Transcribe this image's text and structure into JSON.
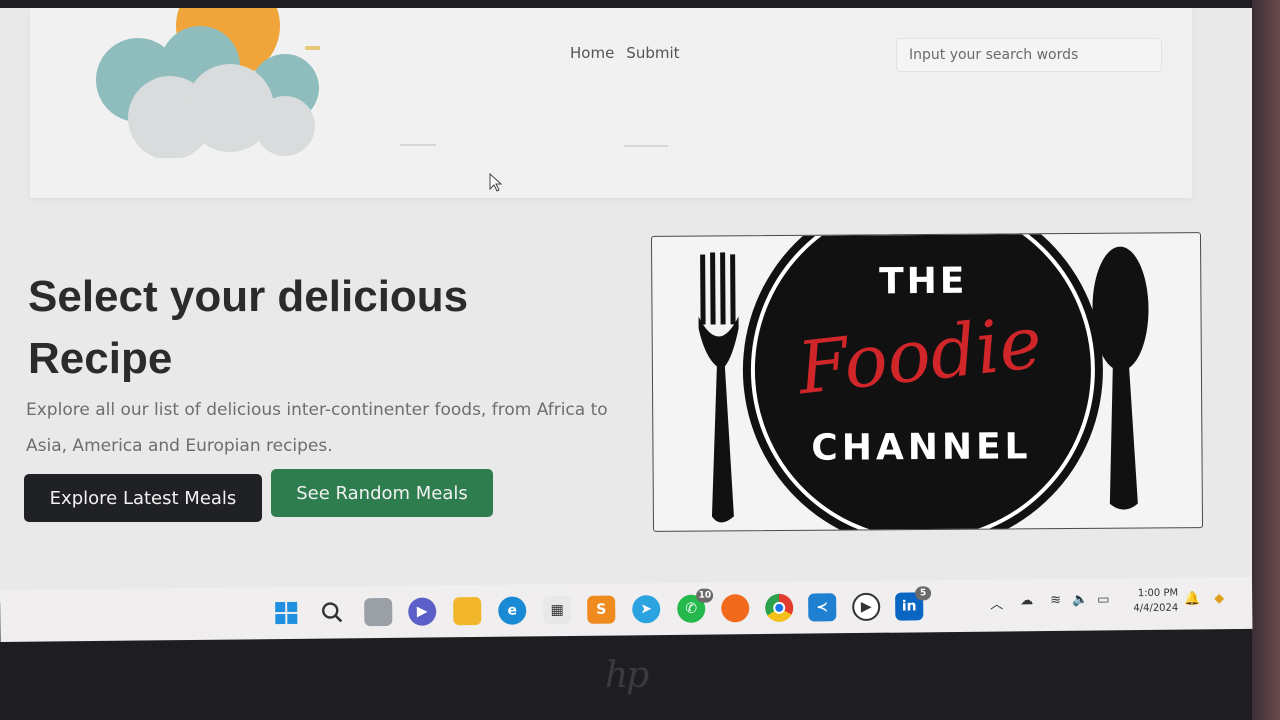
{
  "nav": {
    "home": "Home",
    "submit": "Submit"
  },
  "search": {
    "placeholder": "Input your search words"
  },
  "hero": {
    "title": "Select your delicious Recipe",
    "description": "Explore all our list of delicious inter-continenter foods, from Africa to Asia, America and Europian recipes.",
    "explore_button": "Explore Latest Meals",
    "random_button": "See Random Meals"
  },
  "banner": {
    "line1": "THE",
    "line2": "Foodie",
    "line3": "CHANNEL"
  },
  "taskbar": {
    "whatsapp_badge": "10",
    "linkedin_badge": "5",
    "linkedin_label": "in",
    "time": "1:00 PM",
    "date": "4/4/2024",
    "icons": [
      "windows-start",
      "search",
      "task-view",
      "meet",
      "file-explorer",
      "edge",
      "store",
      "sublime-text",
      "telegram",
      "whatsapp",
      "firefox",
      "chrome",
      "vscode",
      "media-player",
      "linkedin"
    ]
  },
  "colors": {
    "dark_button": "#202124",
    "green_button": "#2e7d4f",
    "foodie_red": "#d0262a"
  }
}
